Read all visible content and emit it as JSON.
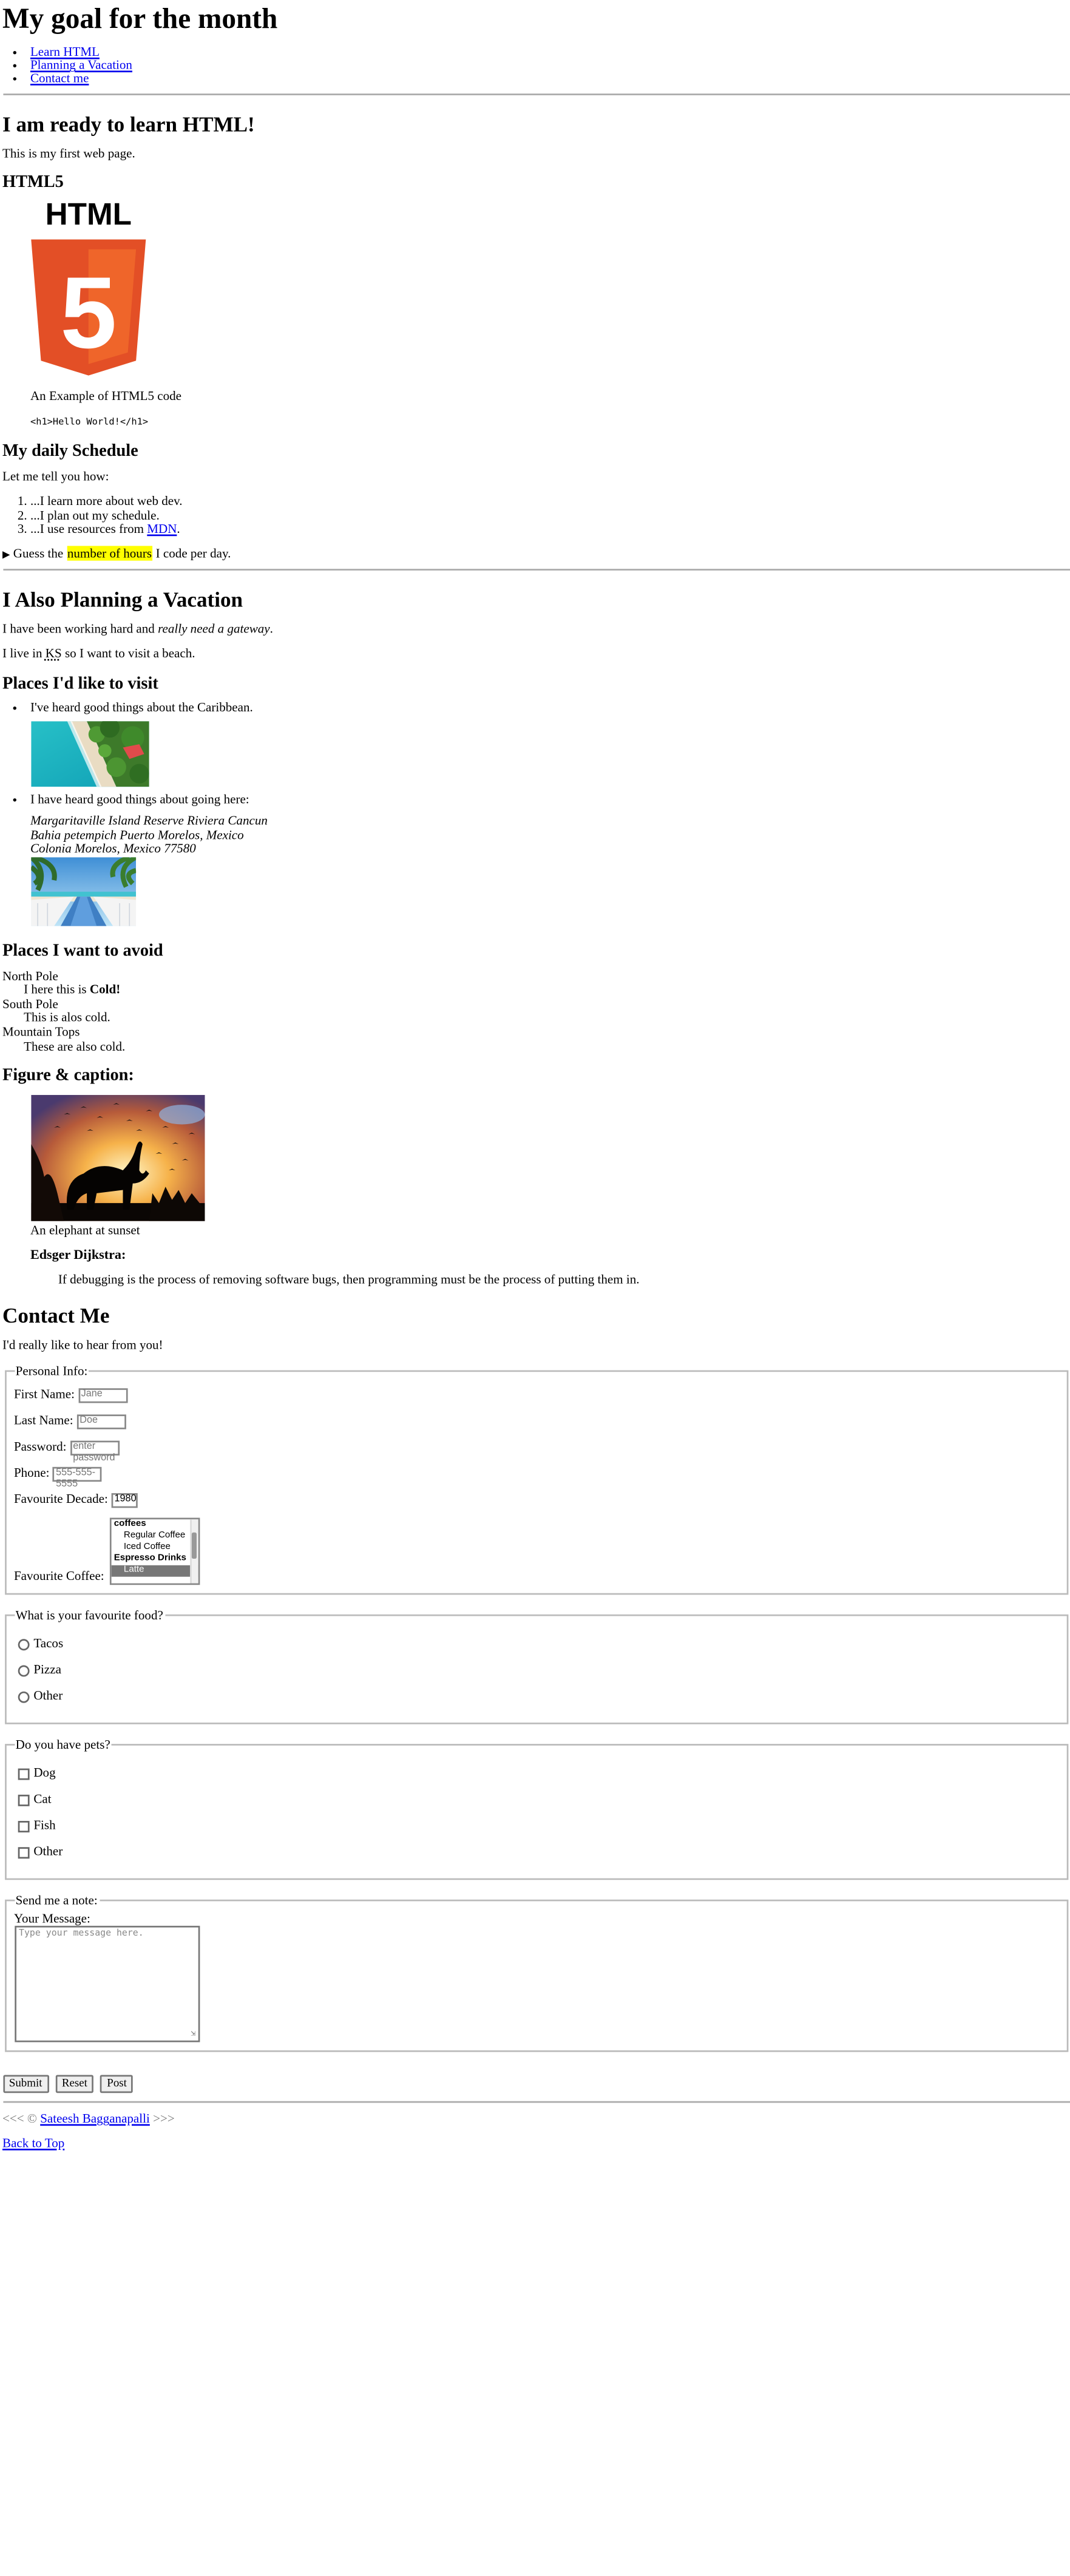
{
  "header": {
    "title": "My goal for the month",
    "nav": [
      "Learn HTML",
      "Planning a Vacation",
      "Contact me"
    ]
  },
  "learn": {
    "heading": "I am ready to learn HTML!",
    "intro": "This is my first web page.",
    "html5_heading": "HTML5",
    "logo_text": "HTML",
    "logo_number": "5",
    "example_label": "An Example of HTML5 code",
    "example_code": "<h1>Hello World!</h1>",
    "schedule_heading": "My daily Schedule",
    "schedule_intro": "Let me tell you how:",
    "schedule": [
      "...I learn more about web dev.",
      "...I plan out my schedule.",
      "...I use resources from "
    ],
    "mdn_link": "MDN",
    "mdn_suffix": ".",
    "details_prefix": "Guess the ",
    "details_mark": "number of hours",
    "details_suffix": " I code per day."
  },
  "vacation": {
    "heading": "I Also Planning a Vacation",
    "p1_prefix": "I have been working hard and ",
    "p1_em": "really need a gateway",
    "p1_suffix": ".",
    "p2_prefix": "I live in ",
    "p2_abbr": "KS",
    "p2_suffix": " so I want to visit a beach.",
    "places_heading": "Places I'd like to visit",
    "place1": "I've heard good things about the Caribbean.",
    "place2": "I have heard good things about going here:",
    "address": [
      "Margaritaville Island Reserve Riviera Cancun",
      "Bahia petempich Puerto Morelos, Mexico",
      "Colonia Morelos, Mexico 77580"
    ],
    "avoid_heading": "Places I want to avoid",
    "avoid": [
      {
        "term": "North Pole",
        "desc_prefix": "I here this is ",
        "desc_bold": "Cold!"
      },
      {
        "term": "South Pole",
        "desc_prefix": "This is alos cold.",
        "desc_bold": ""
      },
      {
        "term": "Mountain Tops",
        "desc_prefix": "These are also cold.",
        "desc_bold": ""
      }
    ],
    "figure_heading": "Figure & caption:",
    "figcaption": "An elephant at sunset",
    "quote_author": "Edsger Dijkstra:",
    "quote": "If debugging is the process of removing software bugs, then programming must be the process of putting them in."
  },
  "contact": {
    "heading": "Contact Me",
    "intro": "I'd really like to hear from you!",
    "personal_legend": "Personal Info:",
    "first_name_label": "First Name:",
    "first_name_placeholder": "Jane",
    "last_name_label": "Last Name:",
    "last_name_placeholder": "Doe",
    "password_label": "Password:",
    "password_placeholder": "enter password",
    "phone_label": "Phone:",
    "phone_placeholder": "555-555-5555",
    "decade_label": "Favourite Decade:",
    "decade_value": "1980",
    "coffee_label": "Favourite Coffee:",
    "coffee_options": [
      {
        "label": "coffees",
        "kind": "grp"
      },
      {
        "label": "Regular Coffee",
        "kind": "sub"
      },
      {
        "label": "Iced Coffee",
        "kind": "sub"
      },
      {
        "label": "Espresso Drinks",
        "kind": "grp"
      },
      {
        "label": "Latte",
        "kind": "sel"
      }
    ],
    "food_legend": "What is your favourite food?",
    "foods": [
      "Tacos",
      "Pizza",
      "Other"
    ],
    "pets_legend": "Do you have pets?",
    "pets": [
      "Dog",
      "Cat",
      "Fish",
      "Other"
    ],
    "note_legend": "Send me a note:",
    "message_label": "Your Message:",
    "message_placeholder": "Type your message here.",
    "buttons": [
      "Submit",
      "Reset",
      "Post"
    ]
  },
  "footer": {
    "left": "<<< © ",
    "author": "Sateesh Bagganapalli",
    "right": " >>>",
    "back_to_top": "Back to Top"
  }
}
